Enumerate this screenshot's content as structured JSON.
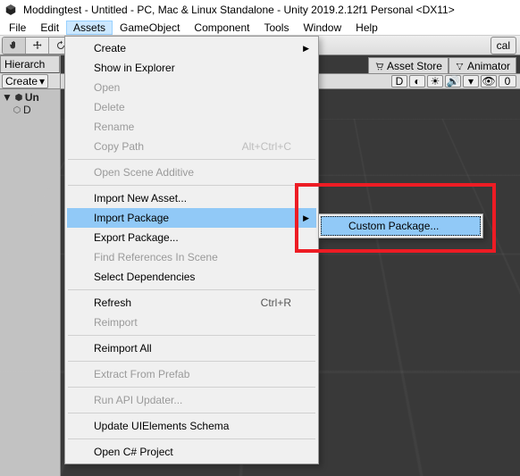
{
  "title": "Moddingtest - Untitled - PC, Mac & Linux Standalone - Unity 2019.2.12f1 Personal <DX11>",
  "menubar": {
    "items": [
      "File",
      "Edit",
      "Assets",
      "GameObject",
      "Component",
      "Tools",
      "Window",
      "Help"
    ],
    "active_index": 2
  },
  "toolbar": {
    "local": "cal"
  },
  "hierarchy": {
    "tab": "Hierarch",
    "create": "Create",
    "rows": [
      {
        "label": "Un",
        "bold": true
      },
      {
        "label": "D",
        "bold": false
      }
    ]
  },
  "scene_tabs": {
    "asset_store": "Asset Store",
    "animator": "Animator"
  },
  "scene_toolbar": {
    "shading": "D",
    "zero": "0"
  },
  "assets_menu": {
    "items": [
      {
        "label": "Create",
        "submenu": true
      },
      {
        "label": "Show in Explorer"
      },
      {
        "label": "Open",
        "disabled": true
      },
      {
        "label": "Delete",
        "disabled": true
      },
      {
        "label": "Rename",
        "disabled": true
      },
      {
        "label": "Copy Path",
        "disabled": true,
        "shortcut": "Alt+Ctrl+C"
      },
      {
        "sep": true
      },
      {
        "label": "Open Scene Additive",
        "disabled": true
      },
      {
        "sep": true
      },
      {
        "label": "Import New Asset..."
      },
      {
        "label": "Import Package",
        "submenu": true,
        "highlight": true
      },
      {
        "label": "Export Package..."
      },
      {
        "label": "Find References In Scene",
        "disabled": true
      },
      {
        "label": "Select Dependencies"
      },
      {
        "sep": true
      },
      {
        "label": "Refresh",
        "shortcut": "Ctrl+R"
      },
      {
        "label": "Reimport",
        "disabled": true
      },
      {
        "sep": true
      },
      {
        "label": "Reimport All"
      },
      {
        "sep": true
      },
      {
        "label": "Extract From Prefab",
        "disabled": true
      },
      {
        "sep": true
      },
      {
        "label": "Run API Updater...",
        "disabled": true
      },
      {
        "sep": true
      },
      {
        "label": "Update UIElements Schema"
      },
      {
        "sep": true
      },
      {
        "label": "Open C# Project"
      }
    ]
  },
  "import_package_submenu": {
    "item": "Custom Package..."
  }
}
